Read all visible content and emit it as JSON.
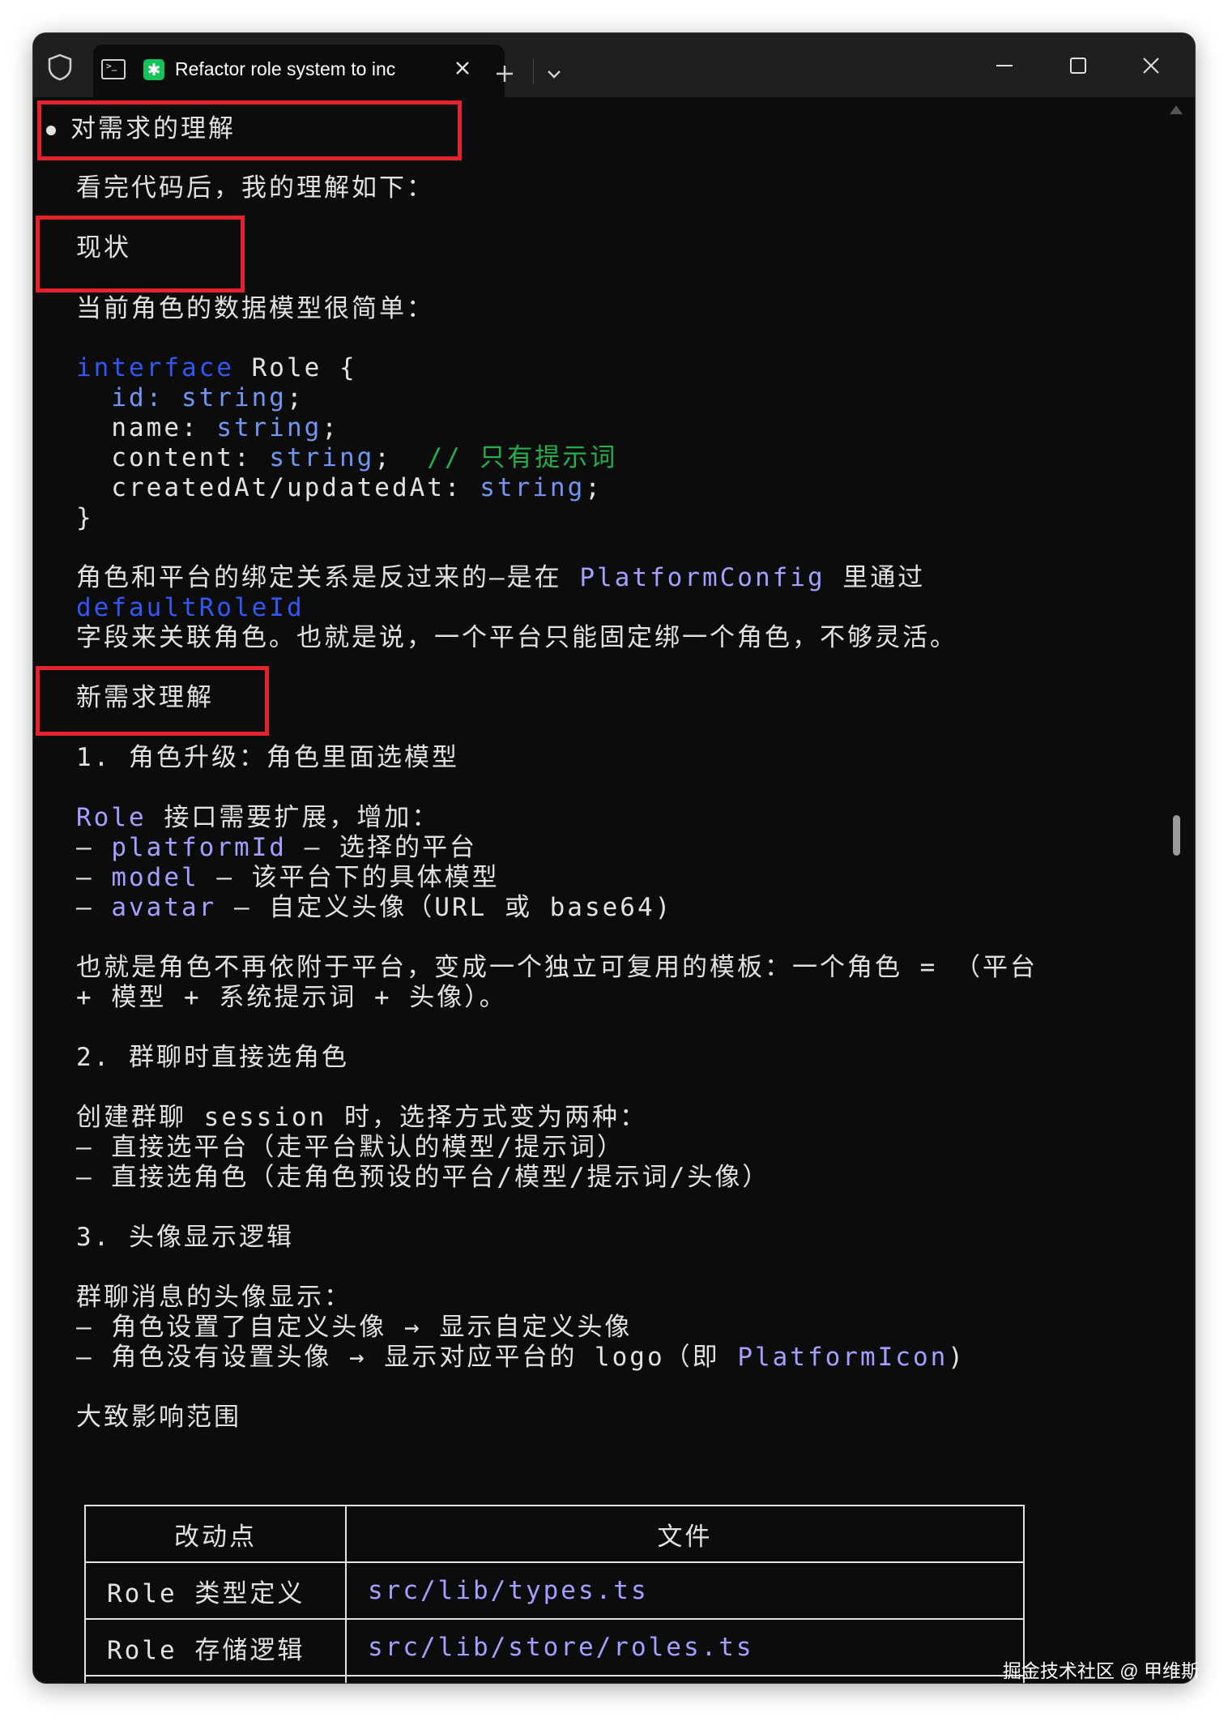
{
  "window": {
    "tab_title": "Refactor role system to inc",
    "tab_icon": "claude-asterisk-icon",
    "accent": "#16c25a"
  },
  "doc": {
    "heading_understanding": "对需求的理解",
    "intro": "看完代码后，我的理解如下：",
    "heading_status": "现状",
    "status_desc": "当前角色的数据模型很简单：",
    "code": {
      "line1_kw": "interface",
      "line1_rest": " Role {",
      "id_key": "  id: ",
      "id_type": "string",
      "semi": ";",
      "name_key": "  name: ",
      "name_type": "string",
      "content_key": "  content: ",
      "content_type": "string",
      "content_comment": "// 只有提示词",
      "created_key": "  createdAt/updatedAt: ",
      "created_type": "string",
      "close": "}"
    },
    "binding_pre": "角色和平台的绑定关系是反过来的—是在 ",
    "binding_code": "PlatformConfig",
    "binding_post": " 里通过",
    "binding_field": "defaultRoleId",
    "binding_line2": "字段来关联角色。也就是说，一个平台只能固定绑一个角色，不够灵活。",
    "heading_new": "新需求理解",
    "item1_title": "1. 角色升级：角色里面选模型",
    "item1_intro_code": "Role",
    "item1_intro_text": " 接口需要扩展，增加：",
    "item1_fields": [
      {
        "code": "platformId",
        "desc": " – 选择的平台"
      },
      {
        "code": "model",
        "desc": " – 该平台下的具体模型"
      },
      {
        "code": "avatar",
        "desc": " – 自定义头像（URL 或 base64)"
      }
    ],
    "item1_summary_1": "也就是角色不再依附于平台，变成一个独立可复用的模板：一个角色 = （平台",
    "item1_summary_2": "+ 模型 + 系统提示词 + 头像）。",
    "item2_title": "2. 群聊时直接选角色",
    "item2_intro": "创建群聊 session 时，选择方式变为两种：",
    "item2_lines": [
      "– 直接选平台（走平台默认的模型/提示词）",
      "– 直接选角色（走角色预设的平台/模型/提示词/头像）"
    ],
    "item3_title": "3. 头像显示逻辑",
    "item3_intro": "群聊消息的头像显示：",
    "item3_line1": "– 角色设置了自定义头像 → 显示自定义头像",
    "item3_line2_pre": "– 角色没有设置头像 → 显示对应平台的 logo（即 ",
    "item3_line2_code": "PlatformIcon",
    "item3_line2_post": ")",
    "heading_scope": "大致影响范围",
    "table": {
      "headers": [
        "改动点",
        "文件"
      ],
      "rows": [
        [
          "Role 类型定义",
          "src/lib/types.ts"
        ],
        [
          "Role 存储逻辑",
          "src/lib/store/roles.ts"
        ]
      ]
    }
  },
  "watermark": "掘金技术社区 @ 甲维斯"
}
